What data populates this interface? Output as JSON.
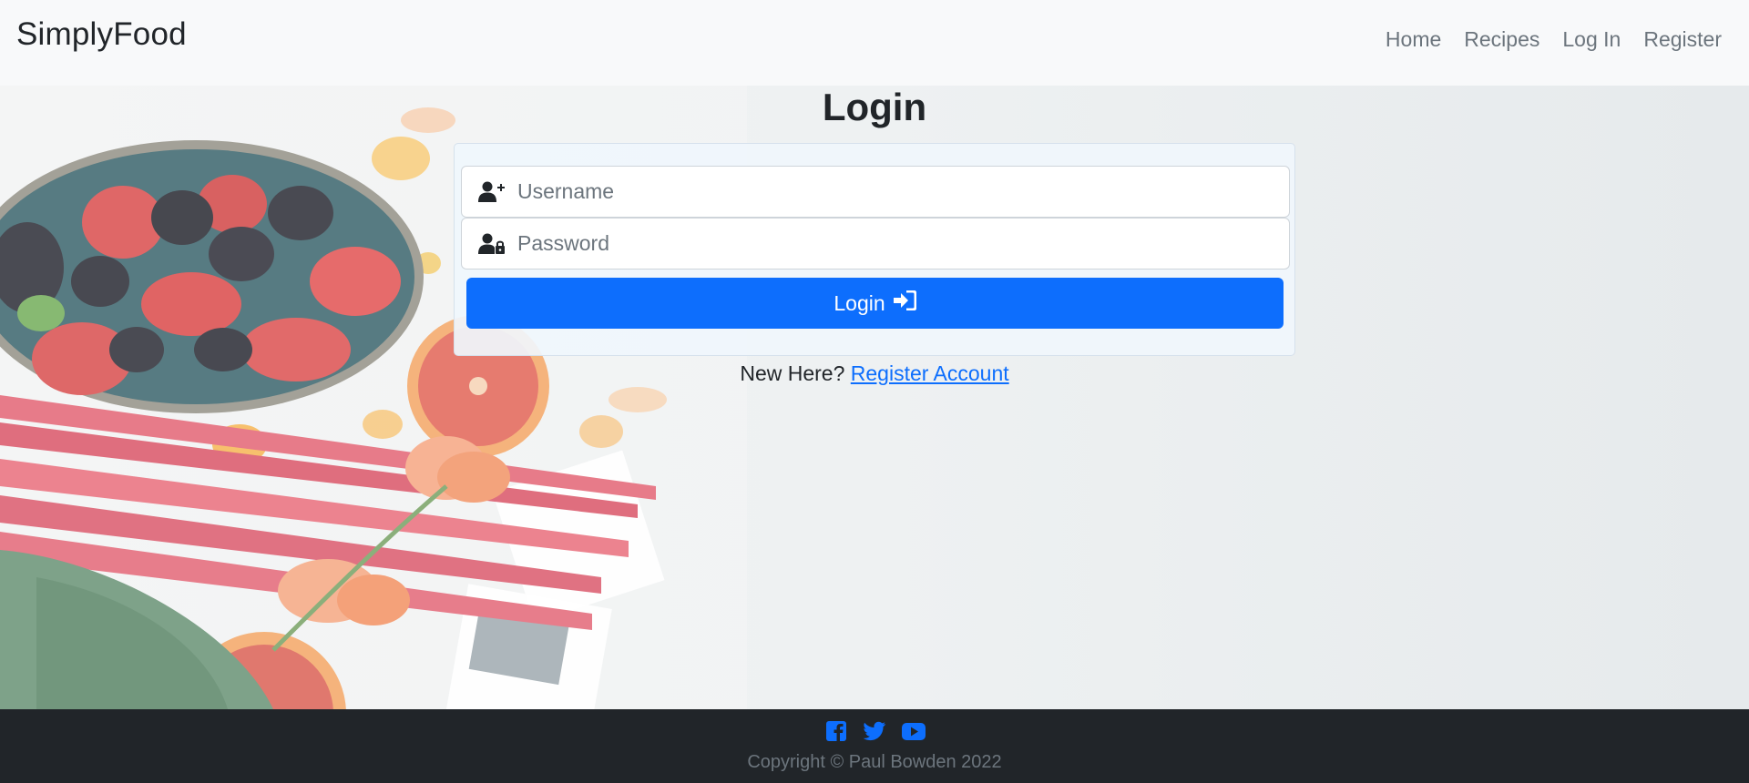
{
  "navbar": {
    "brand": "SimplyFood",
    "links": [
      "Home",
      "Recipes",
      "Log In",
      "Register"
    ]
  },
  "page": {
    "title": "Login"
  },
  "form": {
    "username_placeholder": "Username",
    "password_placeholder": "Password",
    "username_icon": "user-plus-icon",
    "password_icon": "user-lock-icon",
    "submit_label": "Login",
    "submit_icon": "sign-in-icon"
  },
  "register_prompt": {
    "text": "New Here?",
    "link_label": "Register Account"
  },
  "footer": {
    "social_icons": [
      "facebook-icon",
      "twitter-icon",
      "youtube-icon"
    ],
    "copyright": "Copyright © Paul Bowden 2022"
  },
  "colors": {
    "primary": "#0d6efd",
    "navbar_bg": "#f8f9fa",
    "footer_bg": "#212529",
    "muted_text": "#6c757d"
  }
}
